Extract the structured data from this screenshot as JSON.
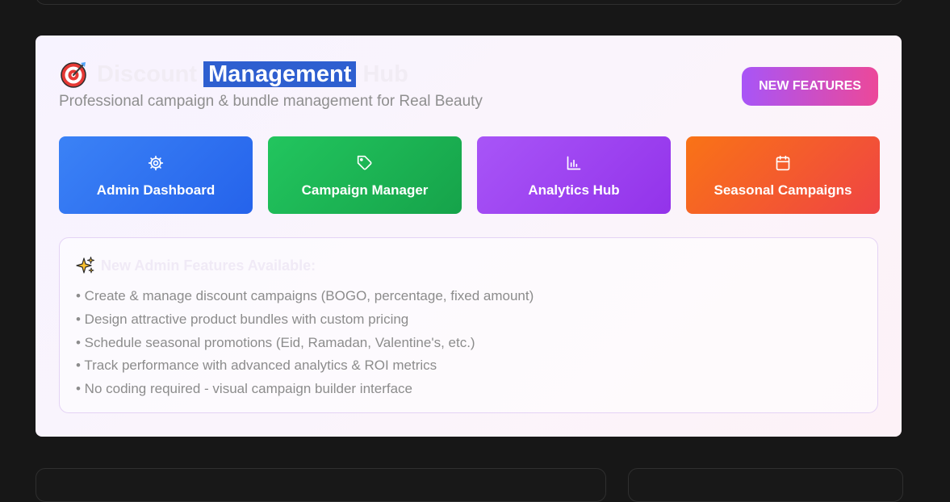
{
  "header": {
    "title_part1": "Discount ",
    "title_selected": "Management",
    "title_part2": " Hub",
    "subtitle": "Professional campaign & bundle management for Real Beauty",
    "new_features_label": "NEW FEATURES"
  },
  "nav": [
    {
      "label": "Admin Dashboard",
      "icon": "gear-icon",
      "color": "#2f6fee"
    },
    {
      "label": "Campaign Manager",
      "icon": "tag-icon",
      "color": "#1fb45a"
    },
    {
      "label": "Analytics Hub",
      "icon": "bar-chart-icon",
      "color": "#9d47f0"
    },
    {
      "label": "Seasonal Campaigns",
      "icon": "calendar-icon",
      "color": "#f35f2c"
    }
  ],
  "features": {
    "title": "New Admin Features Available:",
    "items": [
      "• Create & manage discount campaigns (BOGO, percentage, fixed amount)",
      "• Design attractive product bundles with custom pricing",
      "• Schedule seasonal promotions (Eid, Ramadan, Valentine's, etc.)",
      "• Track performance with advanced analytics & ROI metrics",
      "• No coding required - visual campaign builder interface"
    ]
  },
  "colors": {
    "page_bg": "#171717",
    "selection": "#2e5fd0",
    "accent_gradient_start": "#a855f7",
    "accent_gradient_end": "#ec4899"
  }
}
